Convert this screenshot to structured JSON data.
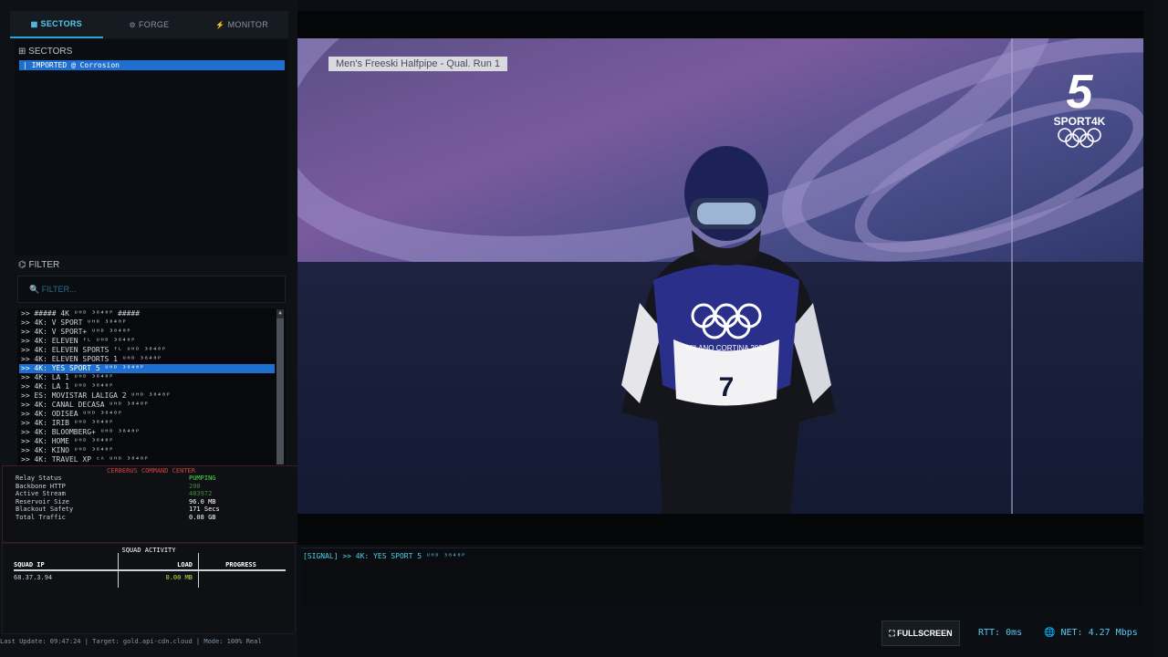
{
  "tabs": [
    {
      "icon": "▦",
      "label": "SECTORS"
    },
    {
      "icon": "⚙",
      "label": "FORGE"
    },
    {
      "icon": "⚡",
      "label": "MONITOR"
    }
  ],
  "sectors": {
    "title": "⊞ SECTORS",
    "items": [
      "| IMPORTED @ Corrosion"
    ]
  },
  "filter": {
    "title": "⌬ FILTER",
    "placeholder": "🔍 FILTER..."
  },
  "channels": [
    ">> ##### 4K ᵁᴴᴰ ³⁸⁴⁰ᴾ #####",
    ">> 4K: V SPORT ᵁᴴᴰ ³⁸⁴⁰ᴾ",
    ">> 4K: V SPORT+ ᵁᴴᴰ ³⁸⁴⁰ᴾ",
    ">> 4K: ELEVEN ᶠᴸ ᵁᴴᴰ ³⁸⁴⁰ᴾ",
    ">> 4K: ELEVEN SPORTS ᶠᴸ ᵁᴴᴰ ³⁸⁴⁰ᴾ",
    ">> 4K: ELEVEN SPORTS 1 ᵁᴴᴰ ³⁸⁴⁰ᴾ",
    ">> 4K: YES SPORT 5 ᵁᴴᴰ ³⁸⁴⁰ᴾ",
    ">> 4K: LA 1 ᵁᴴᴰ ³⁸⁴⁰ᴾ",
    ">> 4K: LA 1 ᵁᴴᴰ ³⁸⁴⁰ᴾ",
    ">> ES: MOVISTAR  LALIGA 2 ᵁᴴᴰ ³⁸⁴⁰ᴾ",
    ">> 4K: CANAL DECASA ᵁᴴᴰ ³⁸⁴⁰ᴾ",
    ">> 4K: ODISEA ᵁᴴᴰ ³⁸⁴⁰ᴾ",
    ">> 4K: IRIB ᵁᴴᴰ ³⁸⁴⁰ᴾ",
    ">> 4K: BLOOMBERG+ ᵁᴴᴰ ³⁸⁴⁰ᴾ",
    ">> 4K: HOME ᵁᴴᴰ ³⁸⁴⁰ᴾ",
    ">> 4K: KINO ᵁᴴᴰ ³⁸⁴⁰ᴾ",
    ">> 4K: TRAVEL XP ᶜᴬ ᵁᴴᴰ ³⁸⁴⁰ᴾ"
  ],
  "selected_channel_index": 6,
  "cerberus": {
    "title": "CERBERUS COMMAND CENTER",
    "rows": [
      {
        "k": "Relay Status",
        "v": "PUMPING"
      },
      {
        "k": "Backbone HTTP",
        "v": "200"
      },
      {
        "k": "Active Stream",
        "v": "483972"
      },
      {
        "k": "Reservoir Size",
        "v": "96.0 MB"
      },
      {
        "k": "Blackout Safety",
        "v": "171 Secs"
      },
      {
        "k": "Total Traffic",
        "v": "0.08 GB"
      }
    ]
  },
  "squad": {
    "title": "SQUAD ACTIVITY",
    "headers": [
      "SQUAD IP",
      "LOAD",
      "PROGRESS"
    ],
    "row": {
      "ip": "68.37.3.94",
      "load": "0.00 MB",
      "progress": ""
    }
  },
  "footer": "Last Update: 09:47:24 | Target: gold.api-cdn.cloud | Mode: 100% Real",
  "video": {
    "caption": "Men's Freeski Halfpipe - Qual. Run 1",
    "logo_number": "5",
    "logo_name": "SPORT4K",
    "bib": "7",
    "bib_text": "MILANO CORTINA 2026"
  },
  "signal": "[SIGNAL] >> 4K: YES SPORT 5 ᵁᴴᴰ ³⁸⁴⁰ᴾ",
  "controls": {
    "fullscreen": "⛶ FULLSCREEN",
    "rtt": "RTT: 0ms",
    "net": "🌐 NET: 4.27 Mbps"
  },
  "colors": {
    "accent": "#2aa7d8",
    "selection": "#1e6fd0",
    "alert": "#d2413c",
    "ok": "#4ad94a"
  }
}
